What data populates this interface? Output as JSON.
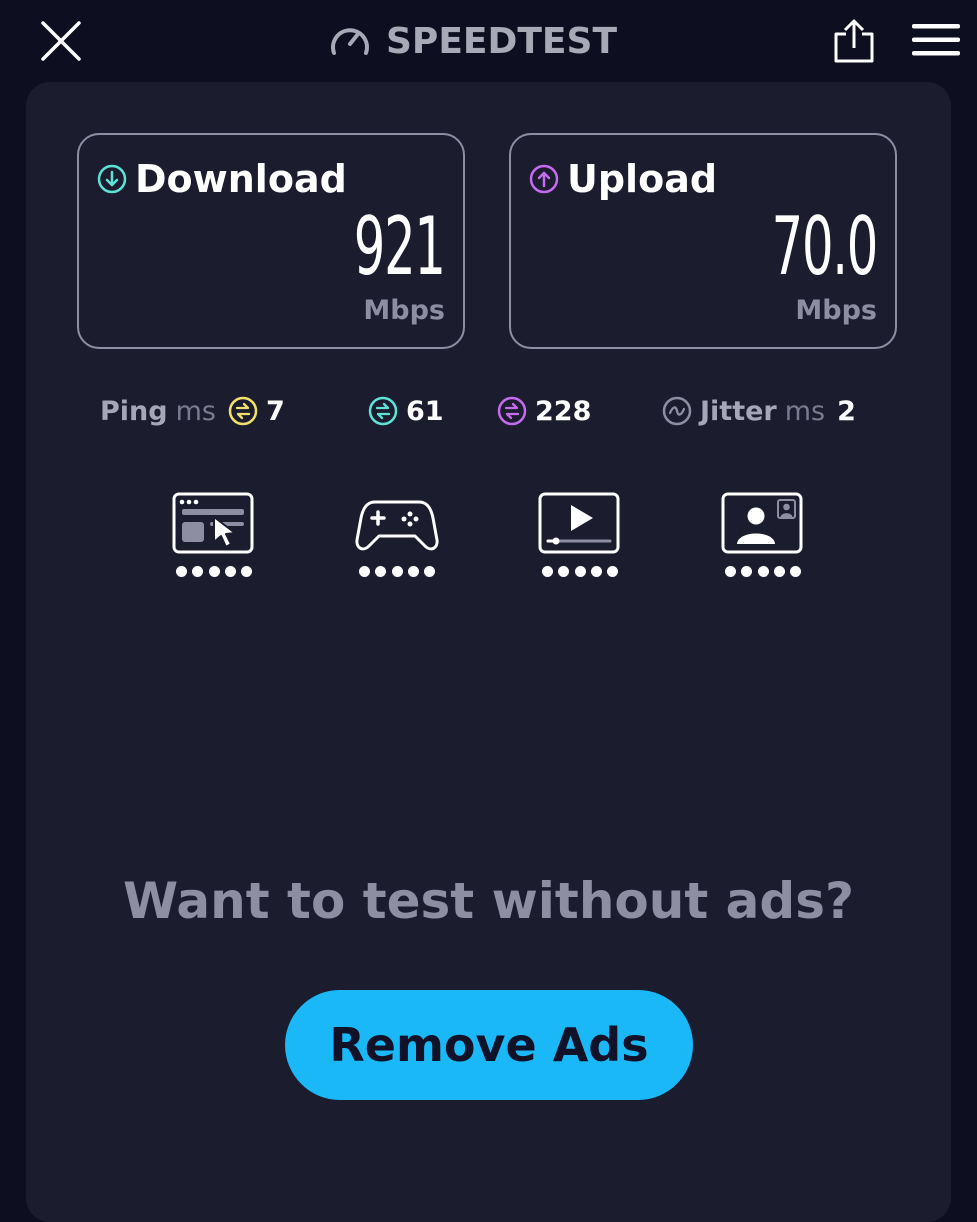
{
  "app": {
    "title": "SPEEDTEST"
  },
  "header": {
    "close_icon": "close-icon",
    "logo_icon": "speedometer-icon",
    "share_icon": "share-icon",
    "menu_icon": "hamburger-menu-icon"
  },
  "download": {
    "label": "Download",
    "value": "921",
    "unit": "Mbps",
    "icon": "arrow-down-circle-icon",
    "color": "#5ee2d8"
  },
  "upload": {
    "label": "Upload",
    "value": "70.0",
    "unit": "Mbps",
    "icon": "arrow-up-circle-icon",
    "color": "#c36cf0"
  },
  "ping": {
    "label": "Ping",
    "unit": "ms",
    "idle": "7",
    "download": "61",
    "upload": "228",
    "idle_color": "#f3e06b",
    "download_color": "#5ee2d8",
    "upload_color": "#c36cf0"
  },
  "jitter": {
    "label": "Jitter",
    "unit": "ms",
    "value": "2"
  },
  "experiences": [
    {
      "name": "browsing",
      "icon": "browser-cursor-icon",
      "rating": 5
    },
    {
      "name": "gaming",
      "icon": "gamepad-icon",
      "rating": 5
    },
    {
      "name": "video-streaming",
      "icon": "video-play-icon",
      "rating": 5
    },
    {
      "name": "video-chat",
      "icon": "video-chat-icon",
      "rating": 5
    }
  ],
  "promo": {
    "text": "Want to test without ads?",
    "button_label": "Remove Ads",
    "button_color": "#1bb8f7"
  }
}
